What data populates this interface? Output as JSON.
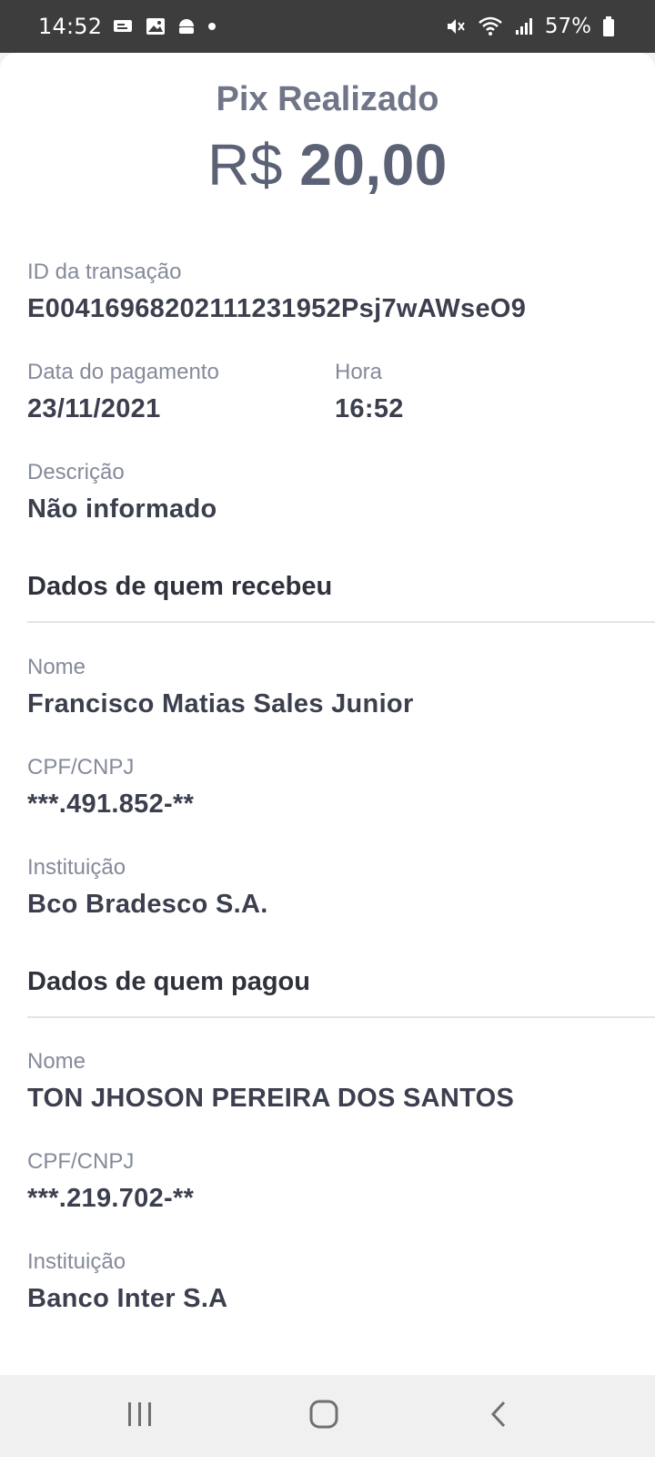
{
  "status_bar": {
    "time": "14:52",
    "battery": "57%",
    "left_icons": [
      "message-icon",
      "image-icon",
      "android-icon",
      "dot-icon"
    ],
    "right_icons": [
      "mute-icon",
      "wifi-icon",
      "signal-icon",
      "battery-icon"
    ]
  },
  "receipt": {
    "title": "Pix Realizado",
    "currency": "R$",
    "amount": "20,00",
    "transaction": {
      "label": "ID da transação",
      "value": "E00416968202111231952Psj7wAWseO9"
    },
    "date": {
      "label": "Data do pagamento",
      "value": "23/11/2021"
    },
    "hour": {
      "label": "Hora",
      "value": "16:52"
    },
    "description": {
      "label": "Descrição",
      "value": "Não informado"
    }
  },
  "receiver": {
    "section_title": "Dados de quem recebeu",
    "name": {
      "label": "Nome",
      "value": "Francisco Matias Sales Junior"
    },
    "doc": {
      "label": "CPF/CNPJ",
      "value": "***.491.852-**"
    },
    "institution": {
      "label": "Instituição",
      "value": "Bco Bradesco S.A."
    }
  },
  "payer": {
    "section_title": "Dados de quem pagou",
    "name": {
      "label": "Nome",
      "value": "TON JHOSON PEREIRA DOS SANTOS"
    },
    "doc": {
      "label": "CPF/CNPJ",
      "value": "***.219.702-**"
    },
    "institution": {
      "label": "Instituição",
      "value": "Banco Inter S.A"
    }
  },
  "nav_bar": {
    "buttons": [
      "recent-apps-icon",
      "home-icon",
      "back-icon"
    ]
  }
}
